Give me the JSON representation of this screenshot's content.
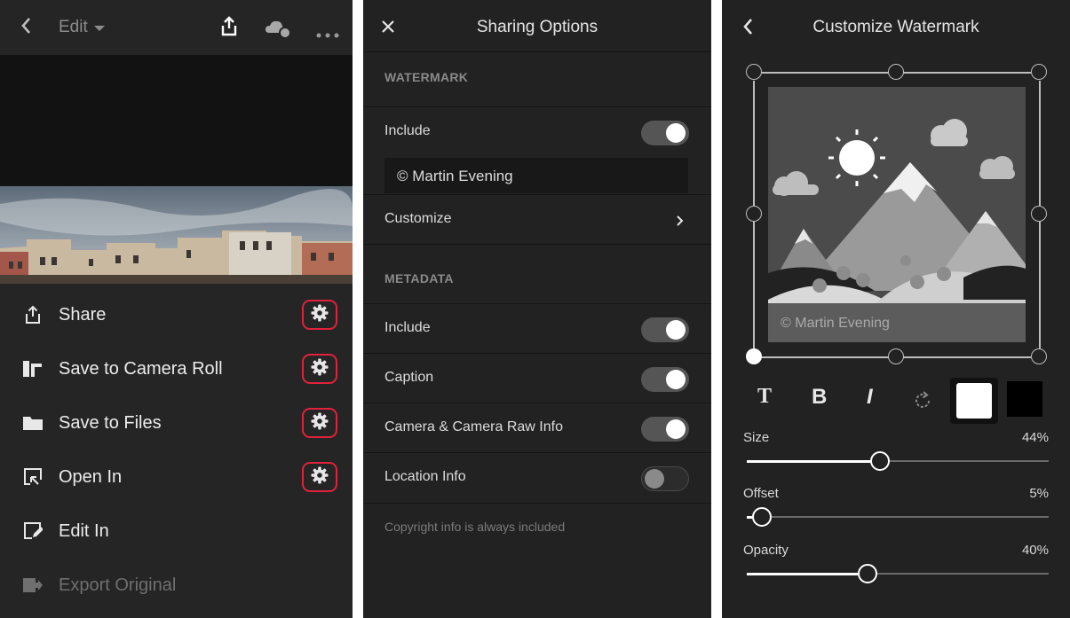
{
  "panel1": {
    "edit_label": "Edit",
    "rows": [
      {
        "label": "Share",
        "gear": true,
        "dim": false
      },
      {
        "label": "Save to Camera Roll",
        "gear": true,
        "dim": false
      },
      {
        "label": "Save to Files",
        "gear": true,
        "dim": false
      },
      {
        "label": "Open In",
        "gear": true,
        "dim": false
      },
      {
        "label": "Edit In",
        "gear": false,
        "dim": false
      },
      {
        "label": "Export Original",
        "gear": false,
        "dim": true
      }
    ],
    "highlight_color": "#e0223b"
  },
  "panel2": {
    "title": "Sharing Options",
    "watermark_header": "WATERMARK",
    "watermark_include": {
      "label": "Include",
      "on": true
    },
    "watermark_text": "© Martin Evening",
    "customize_label": "Customize",
    "metadata_header": "METADATA",
    "metadata_rows": [
      {
        "label": "Include",
        "on": true
      },
      {
        "label": "Caption",
        "on": true
      },
      {
        "label": "Camera & Camera Raw Info",
        "on": true
      },
      {
        "label": "Location Info",
        "on": false
      }
    ],
    "note": "Copyright info is always included"
  },
  "panel3": {
    "title": "Customize Watermark",
    "watermark_preview_text": "© Martin Evening",
    "tools": {
      "text": "T",
      "bold": "B",
      "italic": "I"
    },
    "swatches": {
      "white": "#ffffff",
      "black": "#000000"
    },
    "sliders": [
      {
        "label": "Size",
        "value_text": "44%",
        "level": 0.44
      },
      {
        "label": "Offset",
        "value_text": "5%",
        "level": 0.05
      },
      {
        "label": "Opacity",
        "value_text": "40%",
        "level": 0.4
      }
    ]
  }
}
